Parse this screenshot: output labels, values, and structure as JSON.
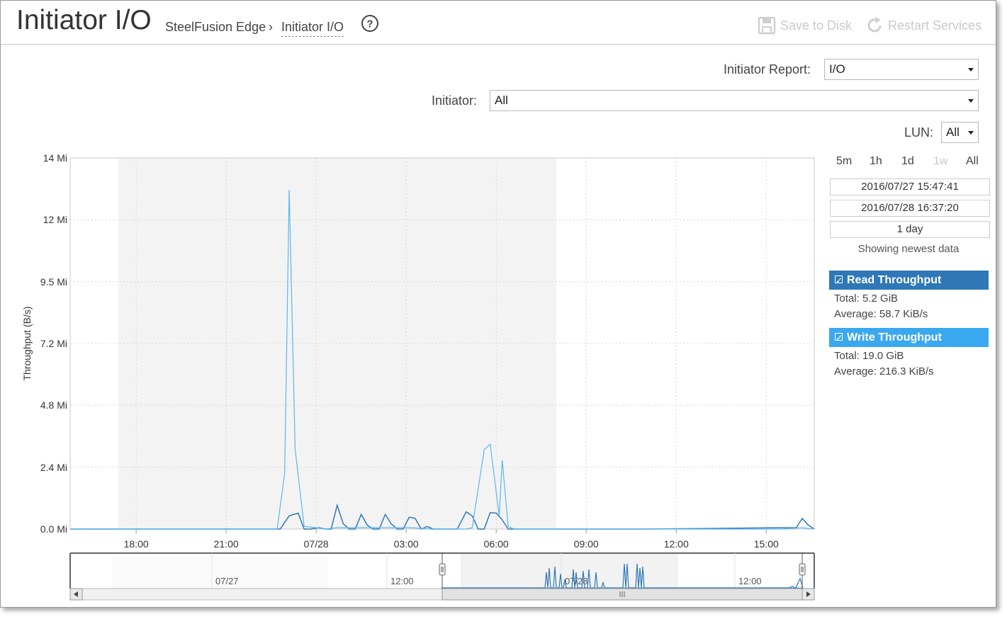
{
  "header": {
    "title": "Initiator I/O",
    "breadcrumb_parent": "SteelFusion Edge",
    "breadcrumb_sep": "›",
    "breadcrumb_current": "Initiator I/O",
    "save_label": "Save to Disk",
    "restart_label": "Restart Services"
  },
  "controls": {
    "initiator_report_label": "Initiator Report:",
    "initiator_report_value": "I/O",
    "initiator_label": "Initiator:",
    "initiator_value": "All",
    "lun_label": "LUN:",
    "lun_value": "All"
  },
  "range": {
    "buttons": [
      {
        "label": "5m",
        "enabled": true
      },
      {
        "label": "1h",
        "enabled": true
      },
      {
        "label": "1d",
        "enabled": true
      },
      {
        "label": "1w",
        "enabled": false
      },
      {
        "label": "All",
        "enabled": true
      }
    ],
    "start": "2016/07/27 15:47:41",
    "end": "2016/07/28 16:37:20",
    "duration": "1 day",
    "status": "Showing newest data"
  },
  "legend": {
    "read": {
      "label": "Read Throughput",
      "total": "Total: 5.2 GiB",
      "average": "Average: 58.7 KiB/s",
      "color": "#2e78b7"
    },
    "write": {
      "label": "Write Throughput",
      "total": "Total: 19.0 GiB",
      "average": "Average: 216.3 KiB/s",
      "color": "#3aa8ef"
    }
  },
  "chart_data": {
    "type": "line",
    "ylabel": "Throughput (B/s)",
    "y_ticks": [
      "0.0 Mi",
      "2.4 Mi",
      "4.8 Mi",
      "7.2 Mi",
      "9.5 Mi",
      "12 Mi",
      "14 Mi"
    ],
    "ylim": [
      0,
      14
    ],
    "x_ticks": [
      "18:00",
      "21:00",
      "07/28",
      "03:00",
      "06:00",
      "09:00",
      "12:00",
      "15:00"
    ],
    "xlim_hours": [
      15.8,
      40.6
    ],
    "shaded_hours": [
      17.4,
      32.0
    ],
    "grid": true,
    "series": [
      {
        "name": "Read Throughput",
        "color": "#2e78b7",
        "x": [
          15.8,
          21.3,
          22.8,
          23.1,
          23.4,
          23.6,
          23.8,
          24.1,
          24.3,
          24.5,
          24.7,
          24.9,
          25.1,
          25.3,
          25.5,
          25.7,
          25.9,
          26.1,
          26.3,
          26.5,
          26.7,
          26.9,
          27.1,
          27.3,
          27.5,
          27.7,
          27.9,
          28.3,
          28.7,
          29.0,
          29.2,
          29.4,
          29.6,
          29.8,
          30.0,
          30.2,
          30.4,
          35.0,
          39.5,
          40.0,
          40.2,
          40.4,
          40.6
        ],
        "y": [
          0,
          0,
          0,
          0.5,
          0.6,
          0,
          0,
          0.05,
          0,
          0,
          0.9,
          0.2,
          0,
          0,
          0.55,
          0.15,
          0,
          0,
          0.55,
          0.2,
          0,
          0,
          0.45,
          0.4,
          0,
          0.1,
          0,
          0,
          0,
          0.65,
          0.5,
          0,
          0,
          0.62,
          0.6,
          0.35,
          0,
          0,
          0.05,
          0.05,
          0.4,
          0.15,
          0
        ]
      },
      {
        "name": "Write Throughput",
        "color": "#5ab6f0",
        "x": [
          15.8,
          21.3,
          22.7,
          22.95,
          23.1,
          23.3,
          23.6,
          24.0,
          24.3,
          24.7,
          25.2,
          25.7,
          26.2,
          26.7,
          27.2,
          27.8,
          28.3,
          29.0,
          29.2,
          29.6,
          29.8,
          30.1,
          30.2,
          30.4,
          30.6,
          35.0,
          39.5,
          40.2,
          40.6
        ],
        "y": [
          0,
          0,
          0,
          2.1,
          12.8,
          3.0,
          0.1,
          0.05,
          0,
          0.05,
          0.05,
          0.05,
          0.05,
          0.05,
          0.05,
          0,
          0,
          0,
          0.05,
          3.0,
          3.2,
          0.5,
          2.6,
          0.1,
          0,
          0,
          0,
          0.05,
          0
        ]
      }
    ],
    "navigator": {
      "x_ticks": [
        "07/27",
        "12:00",
        "07/28",
        "12:00"
      ],
      "shaded": true
    }
  }
}
